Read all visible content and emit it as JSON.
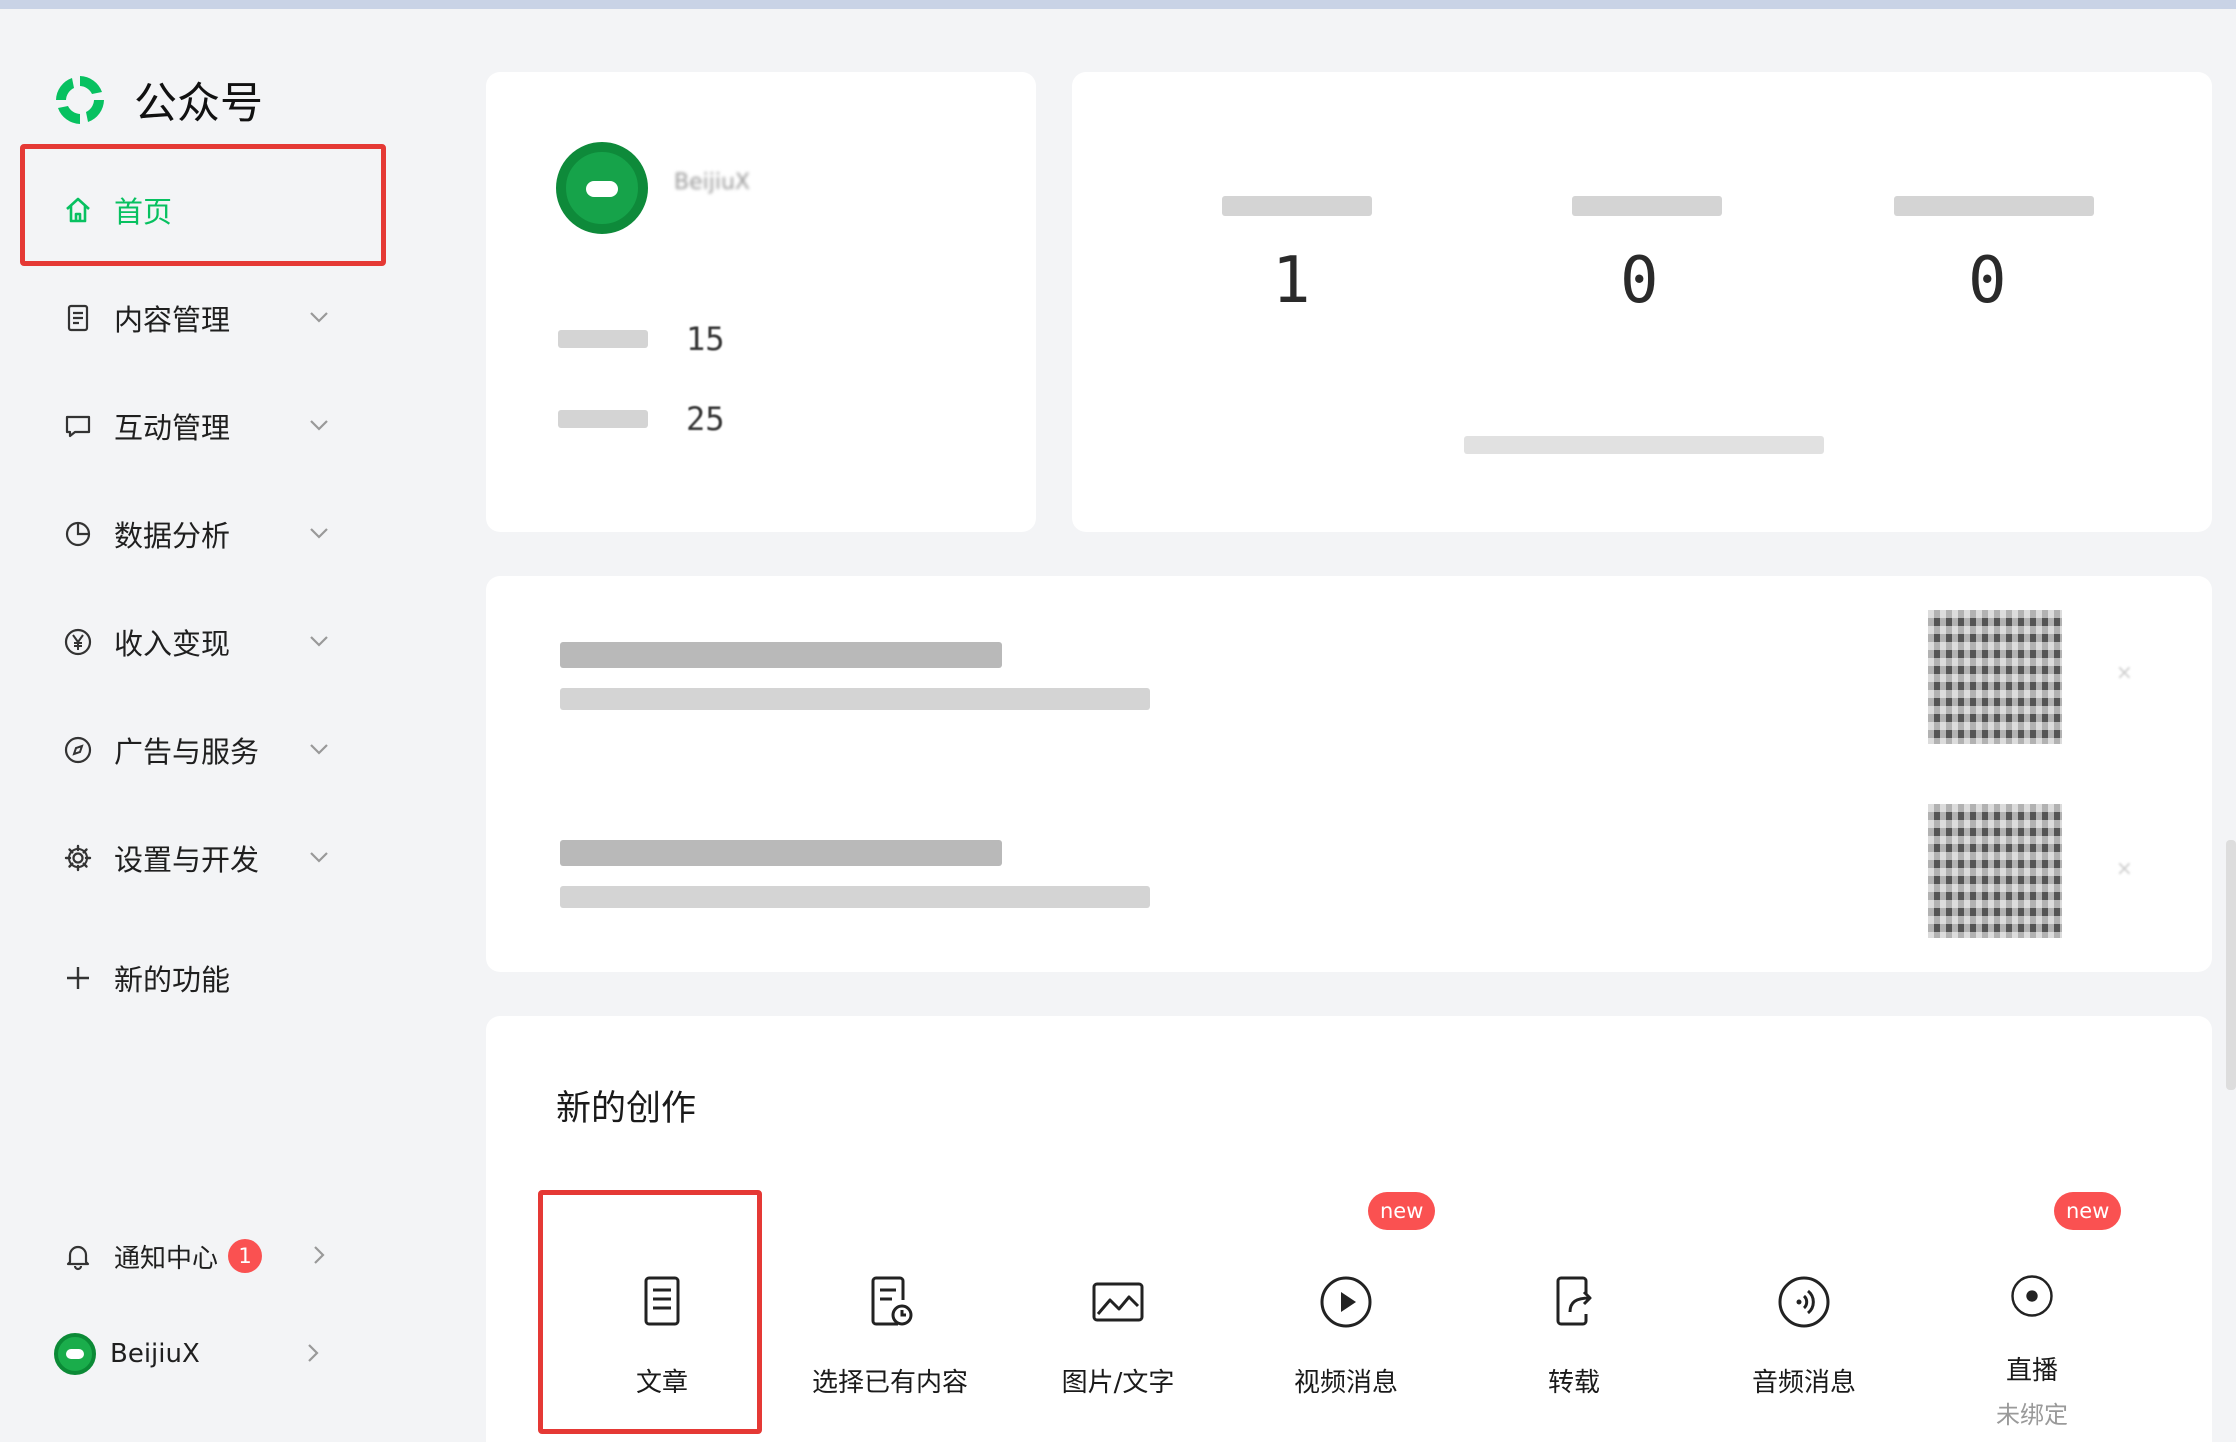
{
  "app": {
    "title": "公众号"
  },
  "sidebar": {
    "home": "首页",
    "items": [
      {
        "label": "内容管理",
        "icon": "document-icon"
      },
      {
        "label": "互动管理",
        "icon": "chat-icon"
      },
      {
        "label": "数据分析",
        "icon": "pie-chart-icon"
      },
      {
        "label": "收入变现",
        "icon": "yen-icon"
      },
      {
        "label": "广告与服务",
        "icon": "compass-icon"
      },
      {
        "label": "设置与开发",
        "icon": "gear-icon"
      }
    ],
    "new_features": "新的功能",
    "notifications": {
      "label": "通知中心",
      "count": "1"
    },
    "account": {
      "name": "BeijiuX"
    }
  },
  "profile": {
    "name": "BeijiuX",
    "stat1": "15",
    "stat2": "25"
  },
  "stats": {
    "values": [
      "1",
      "0",
      "0"
    ]
  },
  "create": {
    "title": "新的创作",
    "tools": [
      {
        "label": "文章",
        "icon": "article-icon"
      },
      {
        "label": "选择已有内容",
        "icon": "existing-content-icon"
      },
      {
        "label": "图片/文字",
        "icon": "image-text-icon"
      },
      {
        "label": "视频消息",
        "icon": "video-icon",
        "badge": "new"
      },
      {
        "label": "转载",
        "icon": "repost-icon"
      },
      {
        "label": "音频消息",
        "icon": "audio-icon"
      },
      {
        "label": "直播",
        "icon": "live-icon",
        "badge": "new",
        "sub": "未绑定"
      }
    ]
  },
  "colors": {
    "accent": "#07c160",
    "highlight": "#e53935",
    "badge": "#fa5151"
  }
}
